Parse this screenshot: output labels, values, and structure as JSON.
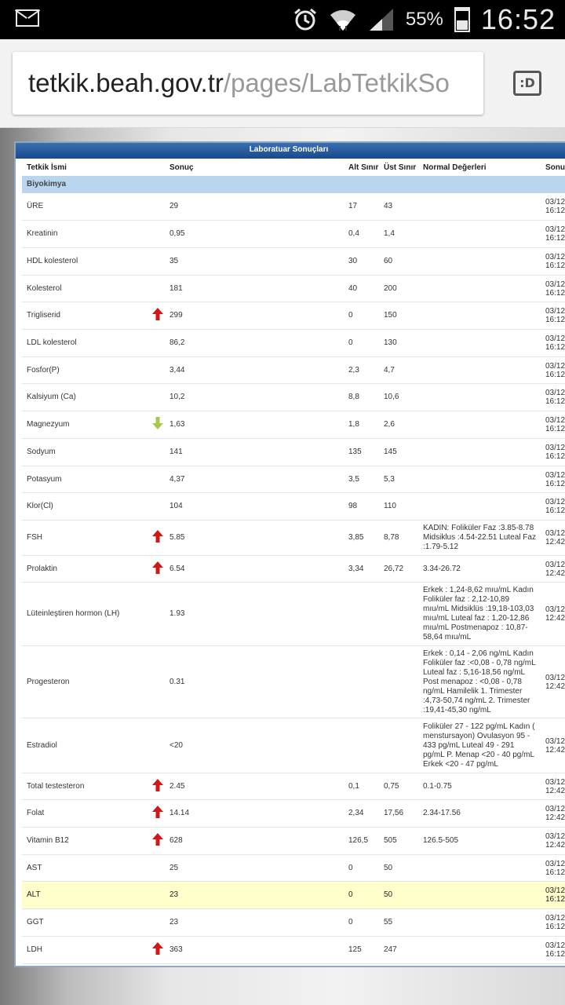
{
  "status": {
    "battery": "55%",
    "time": "16:52"
  },
  "browser": {
    "url_host": "tetkik.beah.gov.tr",
    "url_path": "/pages/LabTetkikSo",
    "tab_label": ":D"
  },
  "panel": {
    "title": "Laboratuar Sonuçları",
    "headers": [
      "Tetkik İsmi",
      "Sonuç",
      "Alt Sınır",
      "Üst Sınır",
      "Normal Değerleri",
      "Sonuç"
    ],
    "group": "Biyokimya",
    "rows": [
      {
        "name": "ÜRE",
        "flag": "",
        "result": "29",
        "low": "17",
        "high": "43",
        "normal": "",
        "date1": "03/12/",
        "date2": "16:12:"
      },
      {
        "name": "Kreatinin",
        "flag": "",
        "result": "0,95",
        "low": "0,4",
        "high": "1,4",
        "normal": "",
        "date1": "03/12/",
        "date2": "16:12:"
      },
      {
        "name": "HDL kolesterol",
        "flag": "",
        "result": "35",
        "low": "30",
        "high": "60",
        "normal": "",
        "date1": "03/12/",
        "date2": "16:12:"
      },
      {
        "name": "Kolesterol",
        "flag": "",
        "result": "181",
        "low": "40",
        "high": "200",
        "normal": "",
        "date1": "03/12/",
        "date2": "16:12:"
      },
      {
        "name": "Trigliserid",
        "flag": "up",
        "result": "299",
        "low": "0",
        "high": "150",
        "normal": "",
        "date1": "03/12/",
        "date2": "16:12:"
      },
      {
        "name": "LDL kolesterol",
        "flag": "",
        "result": "86,2",
        "low": "0",
        "high": "130",
        "normal": "",
        "date1": "03/12/",
        "date2": "16:12:"
      },
      {
        "name": "Fosfor(P)",
        "flag": "",
        "result": "3,44",
        "low": "2,3",
        "high": "4,7",
        "normal": "",
        "date1": "03/12/",
        "date2": "16:12:"
      },
      {
        "name": "Kalsiyum (Ca)",
        "flag": "",
        "result": "10,2",
        "low": "8,8",
        "high": "10,6",
        "normal": "",
        "date1": "03/12/",
        "date2": "16:12:"
      },
      {
        "name": "Magnezyum",
        "flag": "down",
        "result": "1,63",
        "low": "1,8",
        "high": "2,6",
        "normal": "",
        "date1": "03/12/",
        "date2": "16:12:"
      },
      {
        "name": "Sodyum",
        "flag": "",
        "result": "141",
        "low": "135",
        "high": "145",
        "normal": "",
        "date1": "03/12/",
        "date2": "16:12:"
      },
      {
        "name": "Potasyum",
        "flag": "",
        "result": "4,37",
        "low": "3,5",
        "high": "5,3",
        "normal": "",
        "date1": "03/12/",
        "date2": "16:12:"
      },
      {
        "name": "Klor(Cl)",
        "flag": "",
        "result": "104",
        "low": "98",
        "high": "110",
        "normal": "",
        "date1": "03/12/",
        "date2": "16:12:"
      },
      {
        "name": "FSH",
        "flag": "up",
        "result": "5.85",
        "low": "3,85",
        "high": "8,78",
        "normal": "KADIN: Foliküler Faz :3.85-8.78 Midsiklus :4.54-22.51 Luteal Faz :1.79-5.12",
        "date1": "03/12/",
        "date2": "12:42:"
      },
      {
        "name": "Prolaktin",
        "flag": "up",
        "result": "6.54",
        "low": "3,34",
        "high": "26,72",
        "normal": "3.34-26.72",
        "date1": "03/12/",
        "date2": "12:42:"
      },
      {
        "name": "Lüteinleştiren hormon (LH)",
        "flag": "",
        "result": "1.93",
        "low": "",
        "high": "",
        "normal": "Erkek : 1,24-8,62 mıu/mL Kadın Foliküler faz : 2,12-10,89 mıu/mL Midsiklüs :19,18-103,03 mıu/mL Luteal faz : 1,20-12,86 mıu/mL Postmenapoz : 10,87-58,64 mıu/mL",
        "date1": "03/12/",
        "date2": "12:42:"
      },
      {
        "name": "Progesteron",
        "flag": "",
        "result": "0.31",
        "low": "",
        "high": "",
        "normal": "Erkek : 0,14 - 2,06 ng/mL Kadın Foliküler faz :<0,08 - 0,78 ng/mL Luteal faz : 5,16-18,56 ng/mL Post menapoz : <0,08 - 0,78 ng/mL Hamilelik 1. Trimester :4,73-50,74 ng/mL 2. Trimester :19,41-45,30 ng/mL",
        "date1": "03/12/",
        "date2": "12:42:"
      },
      {
        "name": "Estradiol",
        "flag": "",
        "result": "<20",
        "low": "",
        "high": "",
        "normal": "Foliküler 27 - 122 pg/mL Kadın ( menstursayon) Ovulasyon 95 - 433 pg/mL Luteal 49 - 291 pg/mL P. Menap <20 - 40 pg/mL Erkek <20 - 47 pg/mL",
        "date1": "03/12/",
        "date2": "12:42:"
      },
      {
        "name": "Total testesteron",
        "flag": "up",
        "result": "2.45",
        "low": "0,1",
        "high": "0,75",
        "normal": "0.1-0.75",
        "date1": "03/12/",
        "date2": "12:42:"
      },
      {
        "name": "Folat",
        "flag": "up",
        "result": "14.14",
        "low": "2,34",
        "high": "17,56",
        "normal": "2.34-17.56",
        "date1": "03/12/",
        "date2": "12:42:"
      },
      {
        "name": "Vitamin B12",
        "flag": "up",
        "result": "628",
        "low": "126,5",
        "high": "505",
        "normal": "126.5-505",
        "date1": "03/12/",
        "date2": "12:42:"
      },
      {
        "name": "AST",
        "flag": "",
        "result": "25",
        "low": "0",
        "high": "50",
        "normal": "",
        "date1": "03/12/",
        "date2": "16:12:"
      },
      {
        "name": "ALT",
        "flag": "",
        "result": "23",
        "low": "0",
        "high": "50",
        "normal": "",
        "date1": "03/12/",
        "date2": "16:12:",
        "highlight": true
      },
      {
        "name": "GGT",
        "flag": "",
        "result": "23",
        "low": "0",
        "high": "55",
        "normal": "",
        "date1": "03/12/",
        "date2": "16:12:"
      },
      {
        "name": "LDH",
        "flag": "up",
        "result": "363",
        "low": "125",
        "high": "247",
        "normal": "",
        "date1": "03/12/",
        "date2": "16:12:"
      }
    ]
  }
}
